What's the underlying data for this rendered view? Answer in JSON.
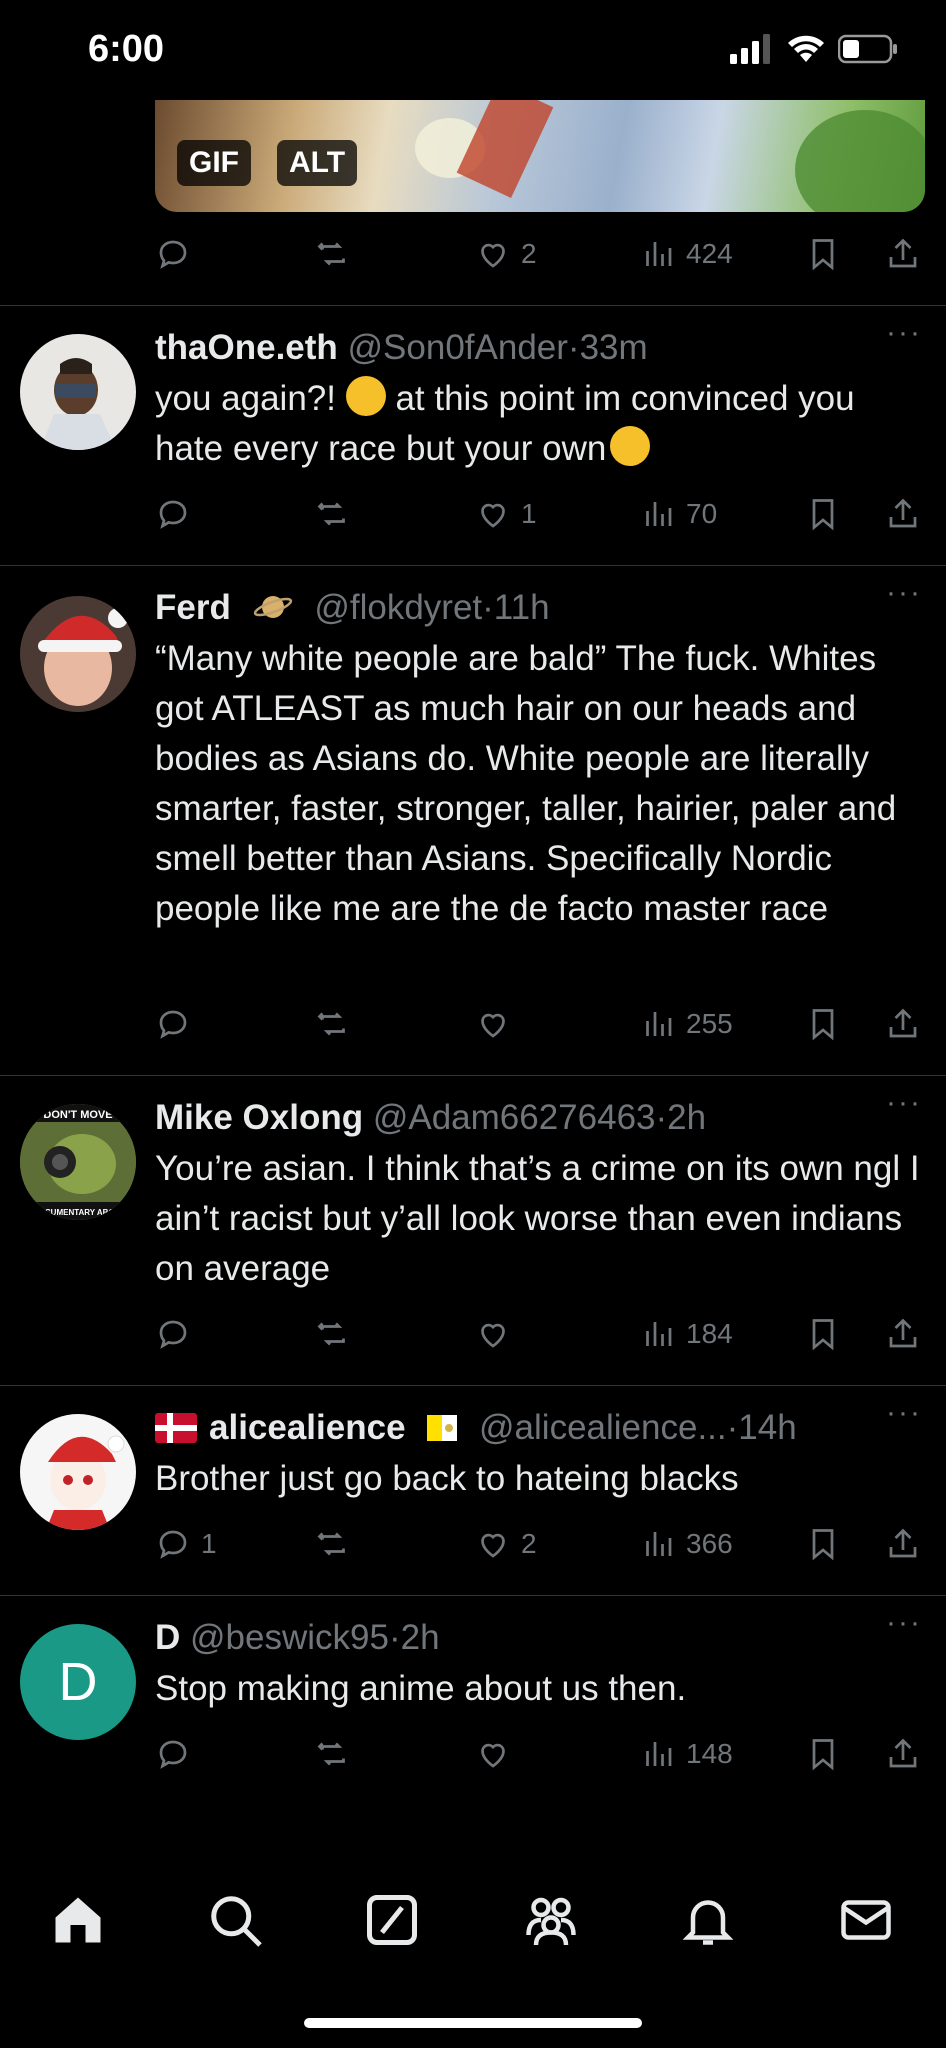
{
  "status_bar": {
    "time": "6:00"
  },
  "media": {
    "gif_label": "GIF",
    "alt_label": "ALT"
  },
  "top_actions": {
    "likes": "2",
    "views": "424"
  },
  "tweets": [
    {
      "name": "thaOne.eth",
      "handle": "@Son0fAnder",
      "time": "33m",
      "body_a": "you again?! ",
      "body_b": " at this point im convinced you hate every race but your own",
      "replies": "",
      "likes": "1",
      "views": "70"
    },
    {
      "name": "Ferd",
      "handle": "@flokdyret",
      "time": "11h",
      "body": "“Many white people are bald” The fuck. Whites got ATLEAST as much hair on our heads and bodies as Asians do. White people are literally smarter, faster, stronger, taller, hairier, paler and smell better than Asians. Specifically Nordic people like me are the de facto master race",
      "replies": "",
      "likes": "",
      "views": "255"
    },
    {
      "name": "Mike Oxlong",
      "handle": "@Adam66276463",
      "time": "2h",
      "body": "You’re asian. I think that’s a crime on its own ngl I ain’t racist but y’all look worse than even indians on average",
      "avatar_text_top": "DON'T MOVE",
      "avatar_text_bottom": "FILMING A DOCUMENTARY ABOUT RETARDS",
      "replies": "",
      "likes": "",
      "views": "184"
    },
    {
      "name": "alicealience",
      "handle": "@alicealience...",
      "time": "14h",
      "body": "Brother just go back to hateing blacks",
      "replies": "1",
      "likes": "2",
      "views": "366"
    },
    {
      "name": "D",
      "handle": "@beswick95",
      "time": "2h",
      "body": "Stop making anime about us then.",
      "avatar_letter": "D",
      "replies": "",
      "likes": "",
      "views": "148"
    }
  ],
  "separator": "·",
  "more_glyph": "···",
  "colors": {
    "background": "#000000",
    "text": "#e7e9ea",
    "muted": "#71767b",
    "divider": "#2f3336",
    "teal_avatar": "#1a9a86"
  }
}
